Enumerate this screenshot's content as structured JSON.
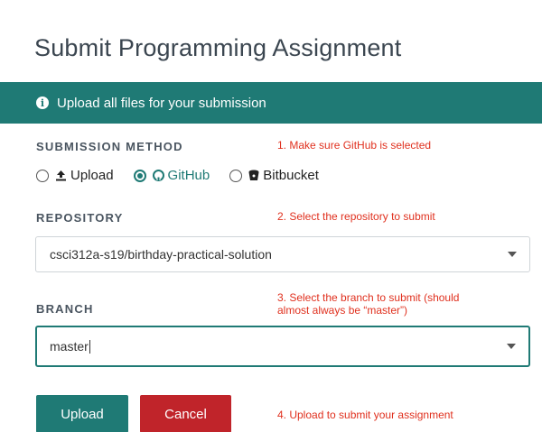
{
  "page": {
    "title": "Submit Programming Assignment"
  },
  "banner": {
    "icon": "info-icon",
    "text": "Upload all files for your submission"
  },
  "submission_method": {
    "label": "SUBMISSION METHOD",
    "options": [
      {
        "label": "Upload",
        "icon": "upload-icon",
        "selected": false
      },
      {
        "label": "GitHub",
        "icon": "github-icon",
        "selected": true
      },
      {
        "label": "Bitbucket",
        "icon": "bitbucket-icon",
        "selected": false
      }
    ]
  },
  "repository": {
    "label": "REPOSITORY",
    "value": "csci312a-s19/birthday-practical-solution"
  },
  "branch": {
    "label": "BRANCH",
    "value": "master"
  },
  "buttons": {
    "upload": "Upload",
    "cancel": "Cancel"
  },
  "notes": {
    "step1": "1. Make sure GitHub is selected",
    "step2": "2. Select the repository to submit",
    "step3_line1": "3. Select the branch to submit (should",
    "step3_line2": "almost always be “master”)",
    "step4": "4. Upload to submit your assignment"
  },
  "colors": {
    "accent": "#1f7a75",
    "danger": "#c0242a",
    "annotation": "#e0301e"
  }
}
